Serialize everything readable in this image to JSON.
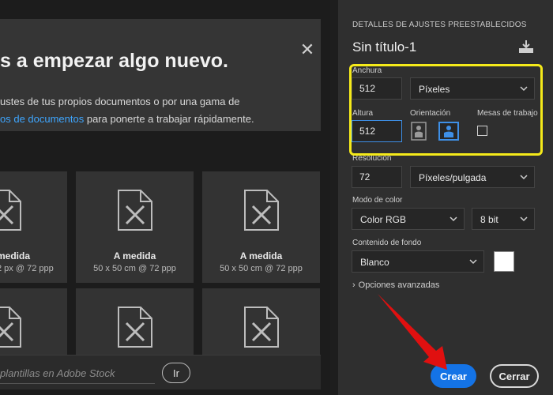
{
  "hero": {
    "title": "s a empezar algo nuevo.",
    "line1": "ustes de tus propios documentos o por una gama de",
    "line2_link": "os de documentos",
    "line2_rest": " para ponerte a trabajar rápidamente."
  },
  "cards": [
    {
      "name": "medida",
      "size": "2 px @ 72 ppp"
    },
    {
      "name": "A medida",
      "size": "50 x 50 cm @ 72 ppp"
    },
    {
      "name": "A medida",
      "size": "50 x 50 cm @ 72 ppp"
    }
  ],
  "stock": {
    "placeholder": "plantillas en Adobe Stock",
    "go_label": "Ir"
  },
  "panel": {
    "header": "DETALLES DE AJUSTES PREESTABLECIDOS",
    "doc_title": "Sin título-1",
    "width_label": "Anchura",
    "width_value": "512",
    "width_unit": "Píxeles",
    "height_label": "Altura",
    "height_value": "512",
    "orientation_label": "Orientación",
    "artboards_label": "Mesas de trabajo",
    "resolution_label": "Resolución",
    "resolution_value": "72",
    "resolution_unit": "Píxeles/pulgada",
    "color_mode_label": "Modo de color",
    "color_mode_value": "Color RGB",
    "bit_depth_value": "8 bit",
    "background_label": "Contenido de fondo",
    "background_value": "Blanco",
    "advanced_label": "Opciones avanzadas",
    "create_label": "Crear",
    "close_label": "Cerrar"
  },
  "colors": {
    "accent": "#1473e6",
    "highlight": "#f5ea1a",
    "arrow": "#e01010",
    "link": "#3ea6ff"
  }
}
